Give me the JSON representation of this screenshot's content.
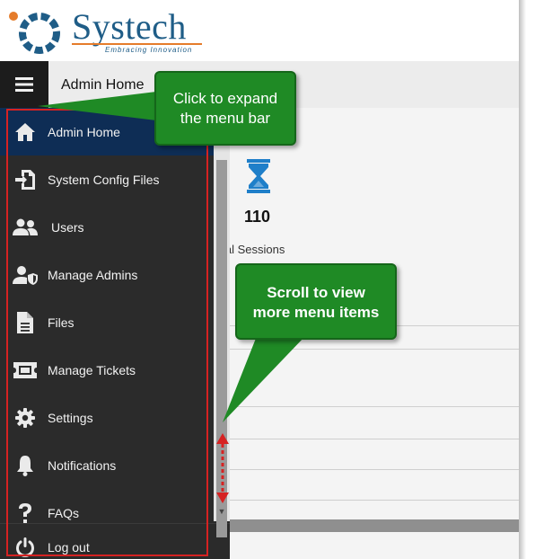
{
  "brand": {
    "name": "Systech",
    "tagline": "Embracing Innovation",
    "colors": {
      "blue": "#1f5d87",
      "orange": "#e57c2b"
    }
  },
  "header": {
    "menu_icon": "hamburger-icon",
    "breadcrumb": "Admin Home"
  },
  "sidebar": {
    "items": [
      {
        "label": "Admin Home",
        "icon": "home-icon",
        "active": true
      },
      {
        "label": "System Config Files",
        "icon": "file-import-icon",
        "active": false
      },
      {
        "label": "Users",
        "icon": "users-icon",
        "active": false
      },
      {
        "label": "Manage Admins",
        "icon": "user-shield-icon",
        "active": false
      },
      {
        "label": "Files",
        "icon": "document-icon",
        "active": false
      },
      {
        "label": "Manage Tickets",
        "icon": "ticket-icon",
        "active": false
      },
      {
        "label": "Settings",
        "icon": "gear-icon",
        "active": false
      },
      {
        "label": "Notifications",
        "icon": "bell-icon",
        "active": false
      },
      {
        "label": "FAQs",
        "icon": "question-icon",
        "active": false
      },
      {
        "label": "Log out",
        "icon": "power-icon",
        "active": false
      }
    ],
    "active_color": "#0e2d55"
  },
  "main": {
    "stat": {
      "icon": "hourglass-icon",
      "value": "110",
      "label": "otal Sessions"
    }
  },
  "callouts": {
    "expand": {
      "line1": "Click to expand",
      "line2": "the menu bar"
    },
    "scroll": {
      "line1": "Scroll to view",
      "line2": "more menu items"
    },
    "color": "#1f8a25"
  },
  "annotation_color": "#d62222"
}
